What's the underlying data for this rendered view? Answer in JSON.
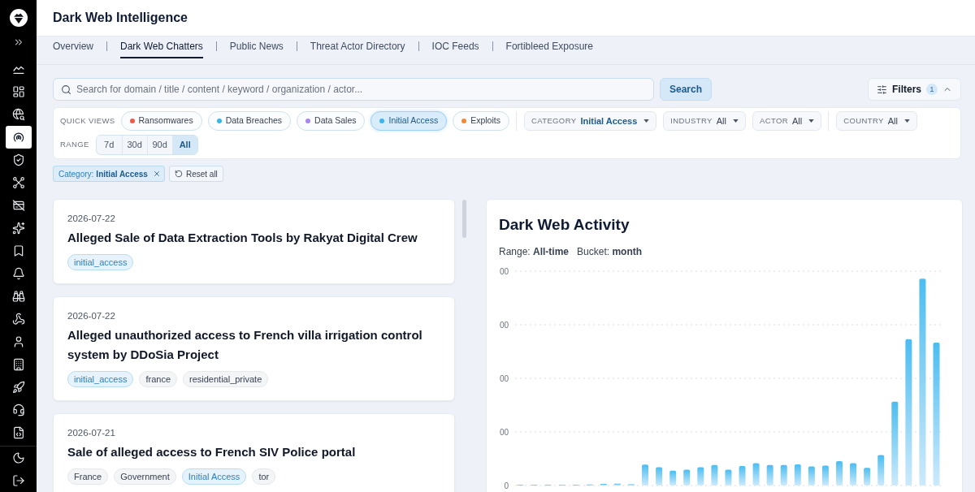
{
  "sidebar": {
    "items": [
      {
        "selected": false
      },
      {
        "selected": false
      },
      {
        "selected": false
      },
      {
        "selected": true
      },
      {
        "selected": false
      },
      {
        "selected": false
      },
      {
        "selected": false
      },
      {
        "selected": false
      },
      {
        "selected": false
      },
      {
        "selected": false
      },
      {
        "selected": false
      },
      {
        "selected": false
      },
      {
        "selected": false
      },
      {
        "selected": false
      },
      {
        "selected": false
      },
      {
        "selected": false
      },
      {
        "selected": false
      }
    ]
  },
  "header": {
    "title": "Dark Web Intelligence"
  },
  "tabs": [
    {
      "label": "Overview",
      "selected": false
    },
    {
      "label": "Dark Web Chatters",
      "selected": true
    },
    {
      "label": "Public News",
      "selected": false
    },
    {
      "label": "Threat Actor Directory",
      "selected": false
    },
    {
      "label": "IOC Feeds",
      "selected": false
    },
    {
      "label": "Fortibleed Exposure",
      "selected": false
    }
  ],
  "search": {
    "placeholder": "Search for domain / title / content / keyword / organization / actor...",
    "button": "Search"
  },
  "filters_button": {
    "label": "Filters",
    "count": "1",
    "expanded": true
  },
  "quick_views": {
    "label": "QUICK VIEWS",
    "items": [
      {
        "label": "Ransomwares",
        "color": "#ef5b4b",
        "selected": false
      },
      {
        "label": "Data Breaches",
        "color": "#35b6e6",
        "selected": false
      },
      {
        "label": "Data Sales",
        "color": "#a886f0",
        "selected": false
      },
      {
        "label": "Initial Access",
        "color": "#3db4f2",
        "selected": true
      },
      {
        "label": "Exploits",
        "color": "#f2883a",
        "selected": false
      }
    ]
  },
  "dropdown_groups": [
    {
      "dropdowns": [
        {
          "label": "CATEGORY",
          "value": "Initial Access",
          "active": true
        },
        {
          "label": "INDUSTRY",
          "value": "All",
          "active": false
        },
        {
          "label": "ACTOR",
          "value": "All",
          "active": false
        }
      ]
    },
    {
      "dropdowns": [
        {
          "label": "COUNTRY",
          "value": "All",
          "active": false
        }
      ]
    }
  ],
  "range": {
    "label": "RANGE",
    "options": [
      {
        "label": "7d",
        "selected": false
      },
      {
        "label": "30d",
        "selected": false
      },
      {
        "label": "90d",
        "selected": false
      },
      {
        "label": "All",
        "selected": true
      }
    ]
  },
  "active_filters": [
    {
      "key": "Category:",
      "value": "Initial Access"
    }
  ],
  "reset_button": "Reset all",
  "articles": [
    {
      "date": "2026-07-22",
      "title": "Alleged Sale of Data Extraction Tools by Rakyat Digital Crew",
      "tags": [
        {
          "label": "initial_access",
          "kind": "category"
        }
      ]
    },
    {
      "date": "2026-07-22",
      "title": "Alleged unauthorized access to French villa irrigation control system by DDoSia Project",
      "tags": [
        {
          "label": "initial_access",
          "kind": "category"
        },
        {
          "label": "france",
          "kind": "plain"
        },
        {
          "label": "residential_private",
          "kind": "plain"
        }
      ]
    },
    {
      "date": "2026-07-21",
      "title": "Sale of alleged access to French SIV Police portal",
      "tags": [
        {
          "label": "France",
          "kind": "plain"
        },
        {
          "label": "Government",
          "kind": "plain"
        },
        {
          "label": "Initial Access",
          "kind": "category"
        },
        {
          "label": "tor",
          "kind": "plain"
        }
      ]
    }
  ],
  "activity": {
    "title": "Dark Web Activity",
    "range": "Range: **All-time**",
    "bucket": "Bucket: **month**",
    "y_tick_labels": [
      "00",
      "00",
      "00",
      "00",
      "0"
    ]
  }
}
